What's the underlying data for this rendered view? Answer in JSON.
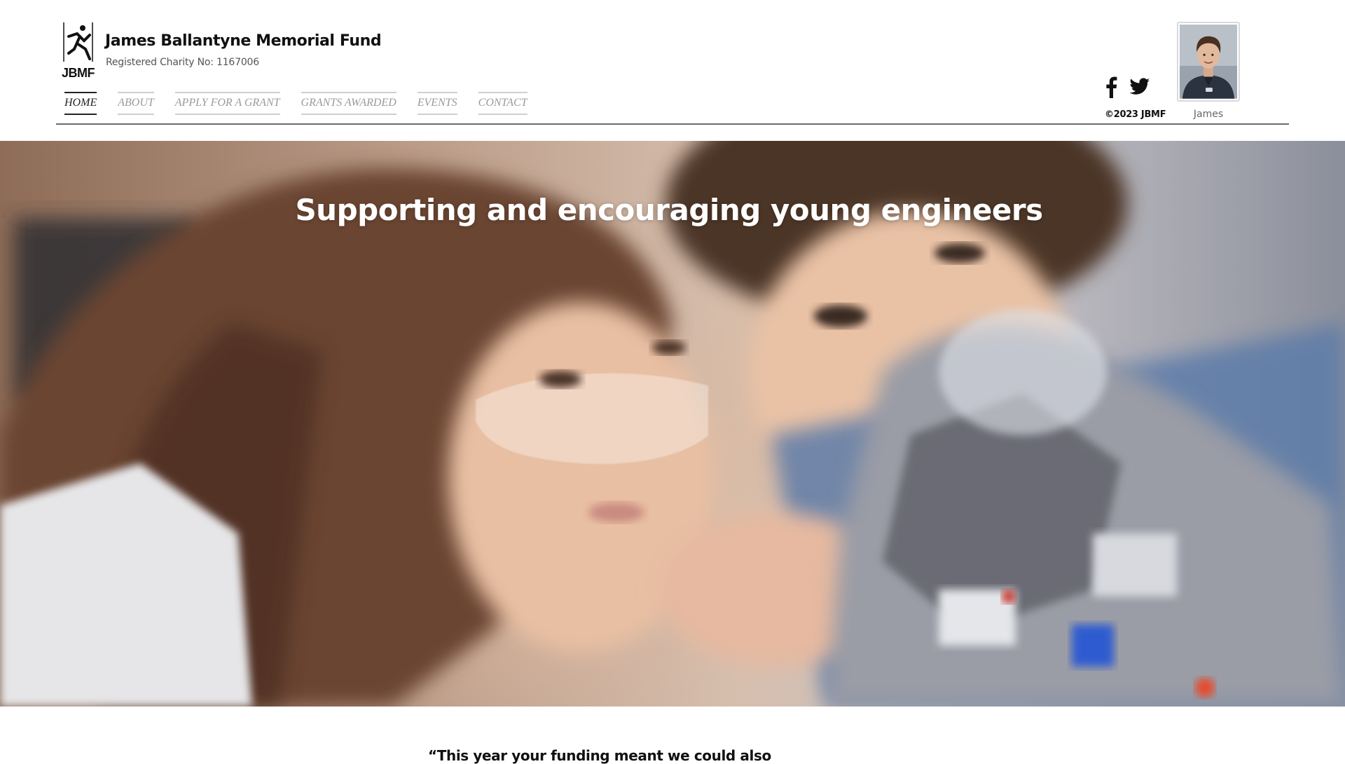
{
  "header": {
    "logo_text": "JBMF",
    "title": "James Ballantyne Memorial Fund",
    "subtitle": "Registered Charity No: 1167006",
    "nav": [
      {
        "label": "HOME",
        "active": true
      },
      {
        "label": "ABOUT",
        "active": false
      },
      {
        "label": "APPLY FOR A GRANT",
        "active": false
      },
      {
        "label": "GRANTS AWARDED",
        "active": false
      },
      {
        "label": "EVENTS",
        "active": false
      },
      {
        "label": "CONTACT",
        "active": false
      }
    ],
    "social": [
      "facebook-icon",
      "twitter-icon"
    ],
    "copyright": "©2023 JBMF",
    "avatar_label": "James"
  },
  "hero": {
    "headline": "Supporting and encouraging young engineers"
  },
  "quote": {
    "text": "“This year your funding meant we could also"
  },
  "colors": {
    "nav_active": "#222222",
    "nav_inactive": "#9a9a9a",
    "hero_text": "#ffffff"
  }
}
